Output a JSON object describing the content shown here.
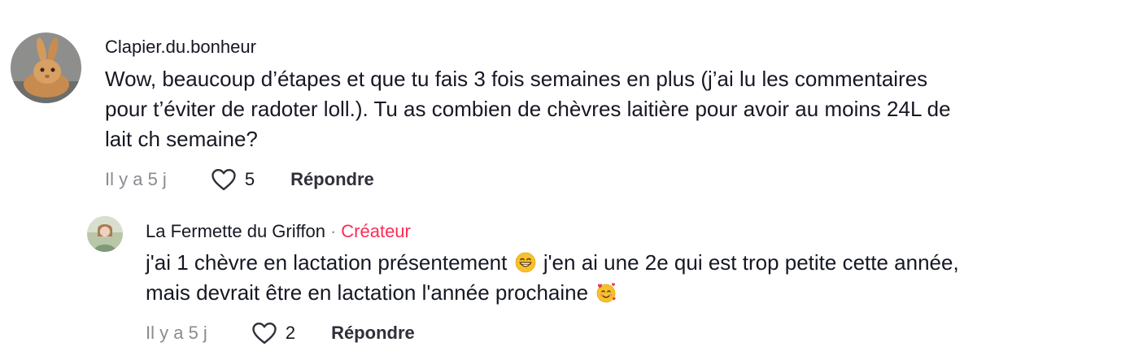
{
  "comments": [
    {
      "username": "Clapier.du.bonheur",
      "text_lines": [
        "Wow, beaucoup d’étapes et que tu fais 3 fois semaines en plus (j’ai lu les commentaires",
        "pour t’éviter de radoter loll.). Tu as combien de chèvres laitière pour avoir au moins 24L de",
        "lait ch semaine?"
      ],
      "timestamp": "Il y a 5 j",
      "likes": "5",
      "reply_label": "Répondre"
    }
  ],
  "replies": [
    {
      "username": "La Fermette du Griffon",
      "separator": "·",
      "creator_label": "Créateur",
      "text_line1_a": "j'ai 1 chèvre en lactation présentement",
      "text_line1_b": "j'en ai une 2e qui est trop petite cette année,",
      "text_line2": "mais devrait être en lactation l'année prochaine",
      "emoji1": "grinning-face-emoji",
      "emoji2": "smiling-face-with-hearts-emoji",
      "timestamp": "Il y a 5 j",
      "likes": "2",
      "reply_label": "Répondre"
    }
  ],
  "colors": {
    "text": "#161823",
    "muted": "#8a8b91",
    "creator_accent": "#fe2c55"
  }
}
